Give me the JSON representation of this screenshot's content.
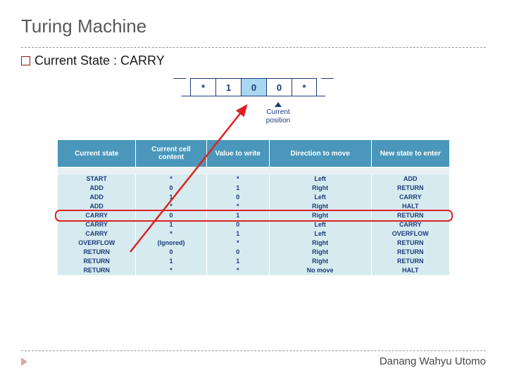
{
  "title": "Turing Machine",
  "state_line": "Current State : CARRY",
  "tape": {
    "cells": [
      "*",
      "1",
      "0",
      "0",
      "*"
    ],
    "highlight_index": 2
  },
  "current_position_label": [
    "Current",
    "position"
  ],
  "table": {
    "headers": [
      "Current state",
      "Current cell content",
      "Value to write",
      "Direction to move",
      "New state to enter"
    ],
    "rows": [
      {
        "state": "START",
        "content": "*",
        "write": "*",
        "dir": "Left",
        "new": "ADD"
      },
      {
        "state": "ADD",
        "content": "0",
        "write": "1",
        "dir": "Right",
        "new": "RETURN"
      },
      {
        "state": "ADD",
        "content": "1",
        "write": "0",
        "dir": "Left",
        "new": "CARRY"
      },
      {
        "state": "ADD",
        "content": "*",
        "write": "*",
        "dir": "Right",
        "new": "HALT"
      },
      {
        "state": "CARRY",
        "content": "0",
        "write": "1",
        "dir": "Right",
        "new": "RETURN"
      },
      {
        "state": "CARRY",
        "content": "1",
        "write": "0",
        "dir": "Left",
        "new": "CARRY"
      },
      {
        "state": "CARRY",
        "content": "*",
        "write": "1",
        "dir": "Left",
        "new": "OVERFLOW"
      },
      {
        "state": "OVERFLOW",
        "content": "(Ignored)",
        "write": "*",
        "dir": "Right",
        "new": "RETURN"
      },
      {
        "state": "RETURN",
        "content": "0",
        "write": "0",
        "dir": "Right",
        "new": "RETURN"
      },
      {
        "state": "RETURN",
        "content": "1",
        "write": "1",
        "dir": "Right",
        "new": "RETURN"
      },
      {
        "state": "RETURN",
        "content": "*",
        "write": "*",
        "dir": "No move",
        "new": "HALT"
      }
    ],
    "highlight_row_index": 4
  },
  "footer": "Danang Wahyu Utomo",
  "colors": {
    "accent": "#4a97bb",
    "highlight": "#e02020"
  }
}
